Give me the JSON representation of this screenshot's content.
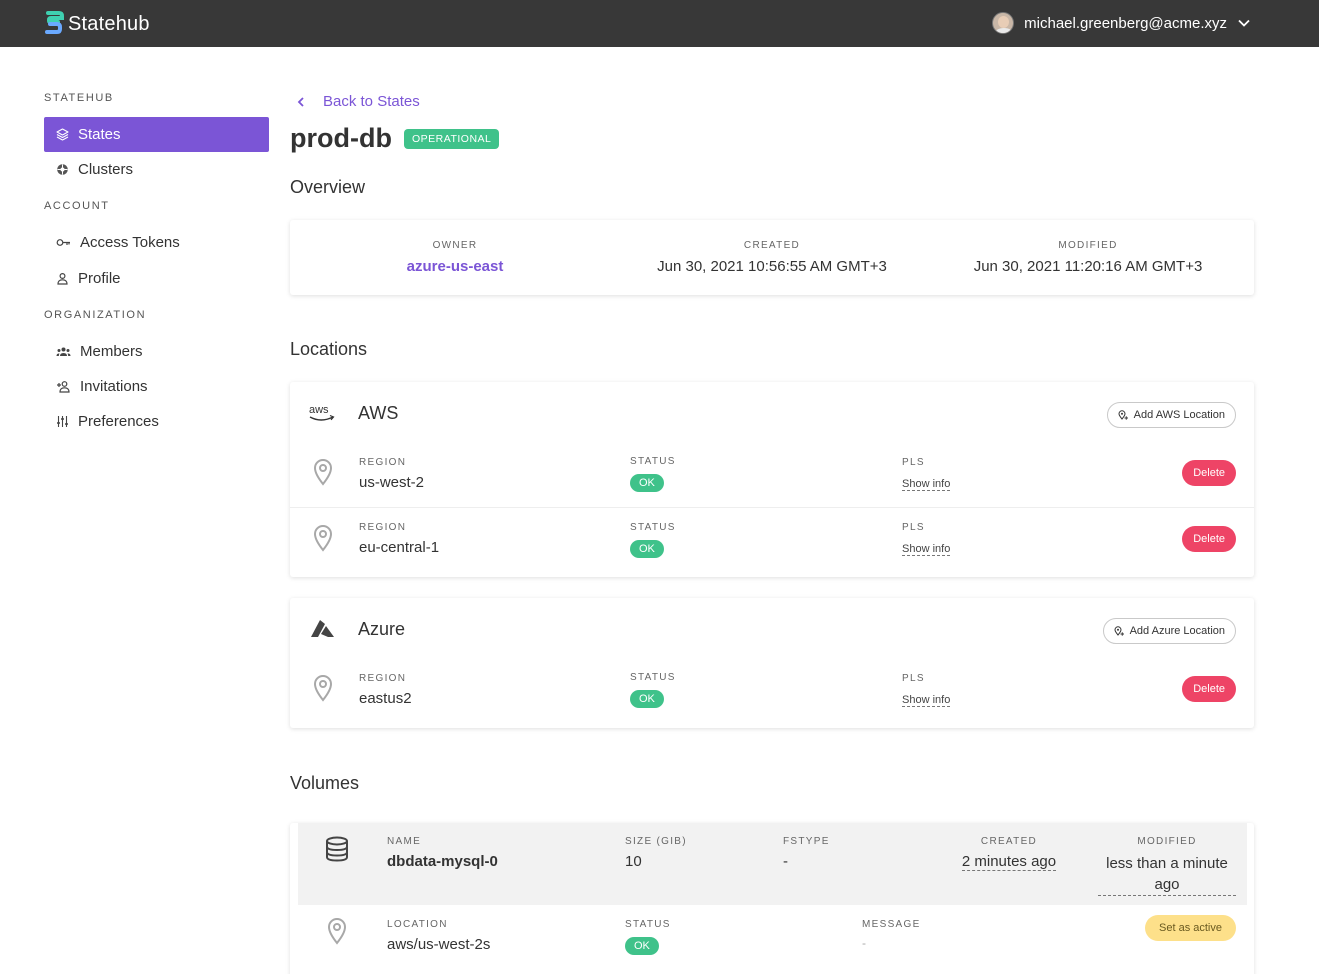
{
  "app": {
    "name": "Statehub",
    "user_email": "michael.greenberg@acme.xyz"
  },
  "sidebar": {
    "sections": [
      {
        "title": "STATEHUB",
        "items": [
          {
            "label": "States",
            "icon": "layers-icon",
            "active": true
          },
          {
            "label": "Clusters",
            "icon": "helm-icon"
          }
        ]
      },
      {
        "title": "ACCOUNT",
        "items": [
          {
            "label": "Access Tokens",
            "icon": "key-icon"
          },
          {
            "label": "Profile",
            "icon": "person-icon"
          }
        ]
      },
      {
        "title": "ORGANIZATION",
        "items": [
          {
            "label": "Members",
            "icon": "group-icon"
          },
          {
            "label": "Invitations",
            "icon": "person-add-icon"
          },
          {
            "label": "Preferences",
            "icon": "sliders-icon"
          }
        ]
      }
    ]
  },
  "page": {
    "back_label": "Back to States",
    "title": "prod-db",
    "status_badge": "OPERATIONAL",
    "overview_heading": "Overview",
    "locations_heading": "Locations",
    "volumes_heading": "Volumes"
  },
  "overview": {
    "owner_label": "OWNER",
    "owner_value": "azure-us-east",
    "created_label": "CREATED",
    "created_value": "Jun 30, 2021 10:56:55 AM GMT+3",
    "modified_label": "MODIFIED",
    "modified_value": "Jun 30, 2021 11:20:16 AM GMT+3"
  },
  "labels": {
    "region": "REGION",
    "status": "STATUS",
    "pls": "PLS",
    "show_info": "Show info",
    "delete": "Delete",
    "ok": "OK"
  },
  "providers": [
    {
      "name": "AWS",
      "add_label": "Add AWS Location",
      "locations": [
        {
          "region": "us-west-2",
          "status": "OK"
        },
        {
          "region": "eu-central-1",
          "status": "OK"
        }
      ]
    },
    {
      "name": "Azure",
      "add_label": "Add Azure Location",
      "locations": [
        {
          "region": "eastus2",
          "status": "OK"
        }
      ]
    }
  ],
  "volume": {
    "name_label": "NAME",
    "name": "dbdata-mysql-0",
    "size_label": "SIZE (GIB)",
    "size": "10",
    "fstype_label": "FSTYPE",
    "fstype": "-",
    "created_label": "CREATED",
    "created": "2 minutes ago",
    "modified_label": "MODIFIED",
    "modified_line1": "less than a minute",
    "modified_line2": "ago",
    "location_label": "LOCATION",
    "location": "aws/us-west-2s",
    "status_label": "STATUS",
    "status": "OK",
    "message_label": "MESSAGE",
    "message": "-",
    "set_active_label": "Set as active"
  },
  "colors": {
    "accent": "#7b55d6",
    "ok": "#3fc28a",
    "danger": "#ee4466",
    "topbar": "#383838",
    "warning": "#fde08a"
  }
}
